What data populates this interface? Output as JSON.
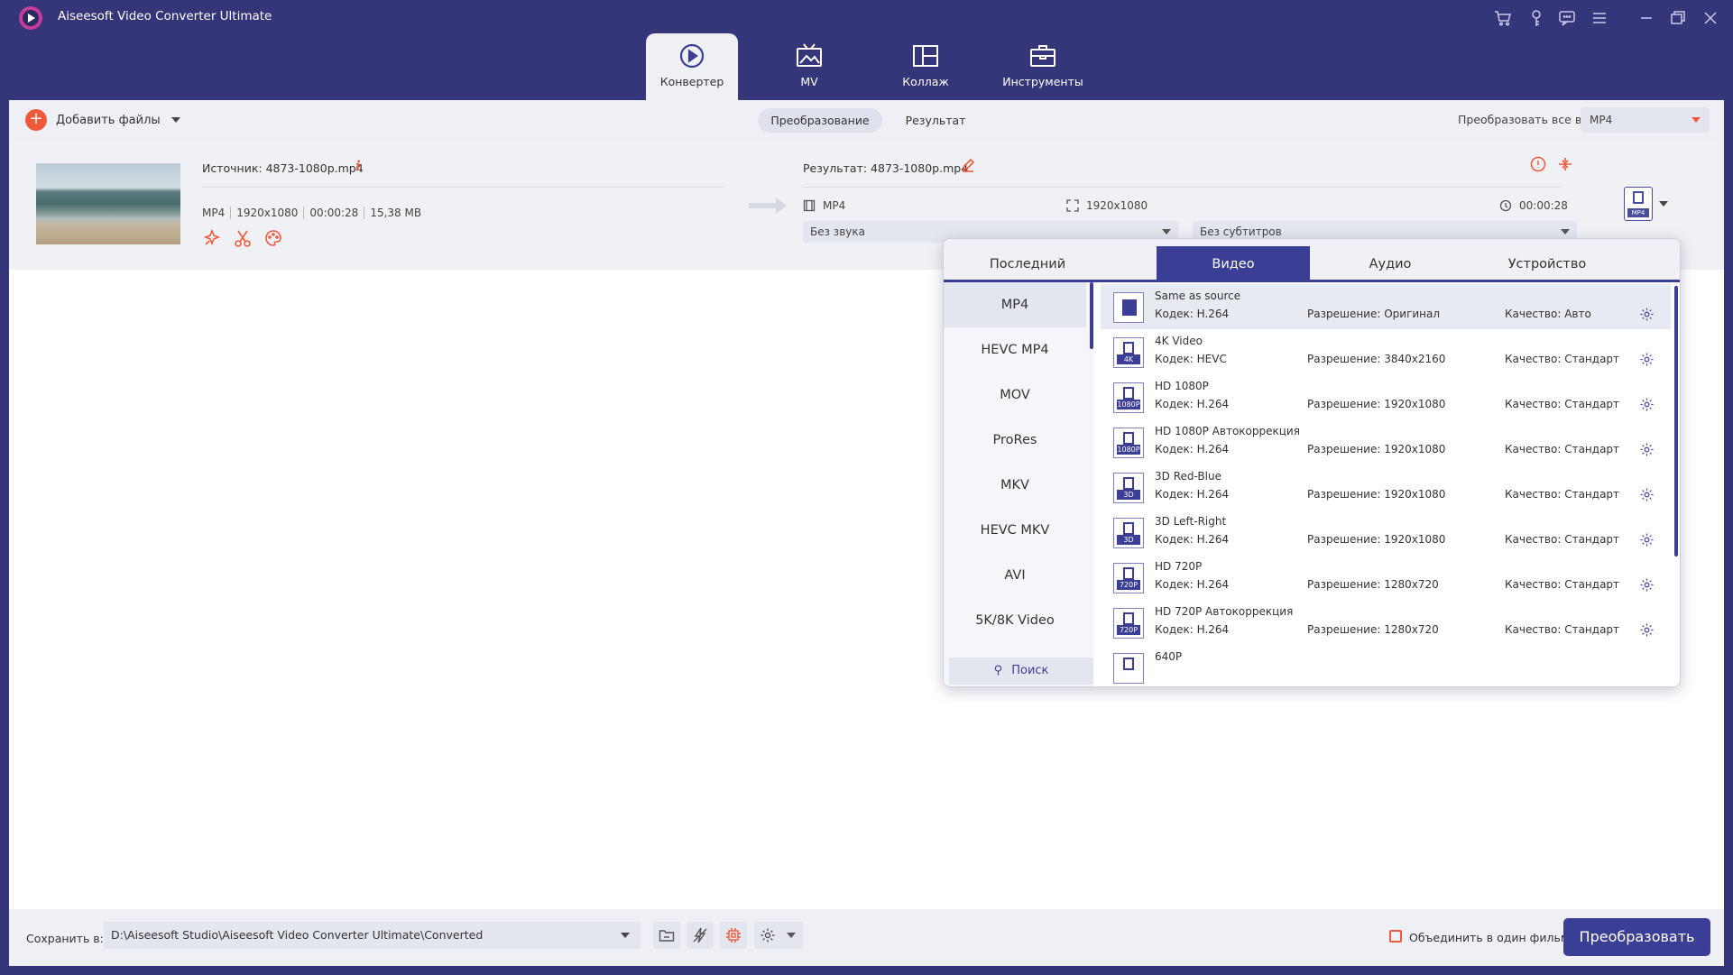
{
  "app": {
    "title": "Aiseesoft Video Converter Ultimate"
  },
  "nav": {
    "tabs": [
      {
        "label": "Конвертер",
        "icon": "converter-icon"
      },
      {
        "label": "MV",
        "icon": "mv-icon"
      },
      {
        "label": "Коллаж",
        "icon": "collage-icon"
      },
      {
        "label": "Инструменты",
        "icon": "toolbox-icon"
      }
    ]
  },
  "window_icons": [
    "cart-icon",
    "key-icon",
    "chat-icon",
    "menu-icon",
    "minimize-icon",
    "restore-icon",
    "close-icon"
  ],
  "toolbar": {
    "add_files": "Добавить файлы",
    "seg_convert": "Преобразование",
    "seg_result": "Результат",
    "convert_all_label": "Преобразовать все в:",
    "convert_all_value": "MP4"
  },
  "file": {
    "source": "Источник: 4873-1080p.mp4",
    "meta": [
      "MP4",
      "1920x1080",
      "00:00:28",
      "15,38 MB"
    ],
    "result": "Результат: 4873-1080p.mp4",
    "res_format": "MP4",
    "res_resolution": "1920x1080",
    "res_duration": "00:00:28",
    "audio_select": "Без звука",
    "subtitle_select": "Без субтитров",
    "format_tag": "MP4"
  },
  "format_panel": {
    "tabs": [
      "Последний",
      "Видео",
      "Аудио",
      "Устройство"
    ],
    "active_tab": "Видео",
    "formats": [
      "MP4",
      "HEVC MP4",
      "MOV",
      "ProRes",
      "MKV",
      "HEVC MKV",
      "AVI",
      "5K/8K Video"
    ],
    "active_format": "MP4",
    "search_label": "Поиск",
    "presets": [
      {
        "name": "Same as source",
        "codec": "Кодек: H.264",
        "resolution": "Разрешение: Оригинал",
        "quality": "Качество: Авто",
        "tag": ""
      },
      {
        "name": "4K Video",
        "codec": "Кодек: HEVC",
        "resolution": "Разрешение: 3840x2160",
        "quality": "Качество: Стандарт",
        "tag": "4K"
      },
      {
        "name": "HD 1080P",
        "codec": "Кодек: H.264",
        "resolution": "Разрешение: 1920x1080",
        "quality": "Качество: Стандарт",
        "tag": "1080P"
      },
      {
        "name": "HD 1080P Автокоррекция",
        "codec": "Кодек: H.264",
        "resolution": "Разрешение: 1920x1080",
        "quality": "Качество: Стандарт",
        "tag": "1080P"
      },
      {
        "name": "3D Red-Blue",
        "codec": "Кодек: H.264",
        "resolution": "Разрешение: 1920x1080",
        "quality": "Качество: Стандарт",
        "tag": "3D"
      },
      {
        "name": "3D Left-Right",
        "codec": "Кодек: H.264",
        "resolution": "Разрешение: 1920x1080",
        "quality": "Качество: Стандарт",
        "tag": "3D"
      },
      {
        "name": "HD 720P",
        "codec": "Кодек: H.264",
        "resolution": "Разрешение: 1280x720",
        "quality": "Качество: Стандарт",
        "tag": "720P"
      },
      {
        "name": "HD 720P Автокоррекция",
        "codec": "Кодек: H.264",
        "resolution": "Разрешение: 1280x720",
        "quality": "Качество: Стандарт",
        "tag": "720P"
      },
      {
        "name": "640P",
        "codec": "",
        "resolution": "",
        "quality": "",
        "tag": ""
      }
    ]
  },
  "bottom": {
    "save_label": "Сохранить в:",
    "save_path": "D:\\Aiseesoft Studio\\Aiseesoft Video Converter Ultimate\\Converted",
    "merge_label": "Объединить в один фильм",
    "convert_button": "Преобразовать"
  }
}
